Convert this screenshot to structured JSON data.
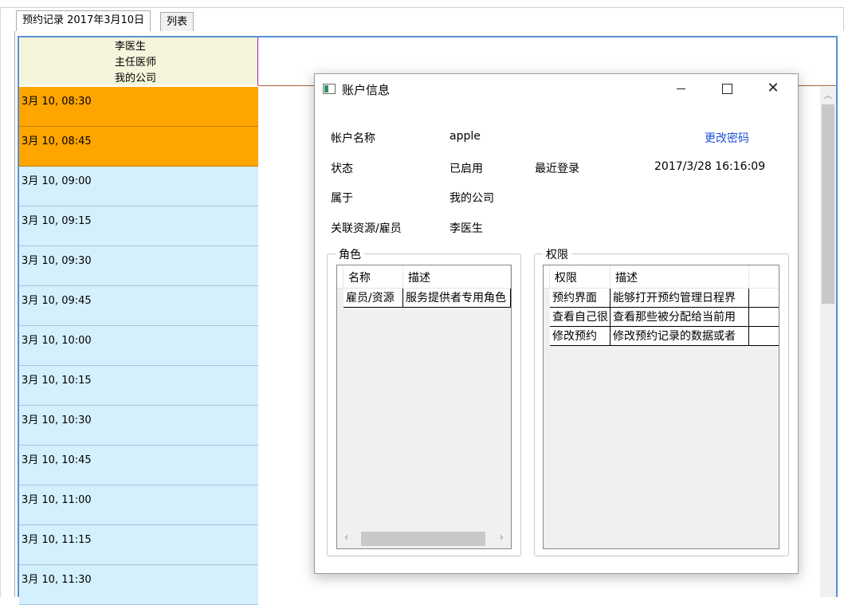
{
  "tabs": [
    {
      "label": "预约记录 2017年3月10日",
      "active": true
    },
    {
      "label": "列表",
      "active": false
    }
  ],
  "resource": {
    "name": "李医生",
    "title": "主任医师",
    "org": "我的公司"
  },
  "slots": [
    {
      "time": "3月 10, 08:30",
      "booked": true
    },
    {
      "time": "3月 10, 08:45",
      "booked": true
    },
    {
      "time": "3月 10, 09:00",
      "booked": false
    },
    {
      "time": "3月 10, 09:15",
      "booked": false
    },
    {
      "time": "3月 10, 09:30",
      "booked": false
    },
    {
      "time": "3月 10, 09:45",
      "booked": false
    },
    {
      "time": "3月 10, 10:00",
      "booked": false
    },
    {
      "time": "3月 10, 10:15",
      "booked": false
    },
    {
      "time": "3月 10, 10:30",
      "booked": false
    },
    {
      "time": "3月 10, 10:45",
      "booked": false
    },
    {
      "time": "3月 10, 11:00",
      "booked": false
    },
    {
      "time": "3月 10, 11:15",
      "booked": false
    },
    {
      "time": "3月 10, 11:30",
      "booked": false
    }
  ],
  "colors": {
    "booked": "#ffa500",
    "free": "#d4f0fd",
    "header": "#f5f5dc",
    "link": "#1a4fd6"
  },
  "dialog": {
    "title": "账户信息",
    "account_name_label": "帐户名称",
    "account_name_value": "apple",
    "change_password": "更改密码",
    "status_label": "状态",
    "status_value": "已启用",
    "last_login_label": "最近登录",
    "last_login_value": "2017/3/28 16:16:09",
    "belongs_label": "属于",
    "belongs_value": "我的公司",
    "linked_label": "关联资源/雇员",
    "linked_value": "李医生",
    "roles": {
      "title": "角色",
      "columns": [
        "名称",
        "描述"
      ],
      "rows": [
        [
          "雇员/资源",
          "服务提供者专用角色"
        ]
      ]
    },
    "permissions": {
      "title": "权限",
      "columns": [
        "权限",
        "描述"
      ],
      "rows": [
        [
          "预约界面",
          "能够打开预约管理日程界"
        ],
        [
          "查看自己很",
          "查看那些被分配给当前用"
        ],
        [
          "修改预约",
          "修改预约记录的数据或者"
        ]
      ]
    }
  }
}
